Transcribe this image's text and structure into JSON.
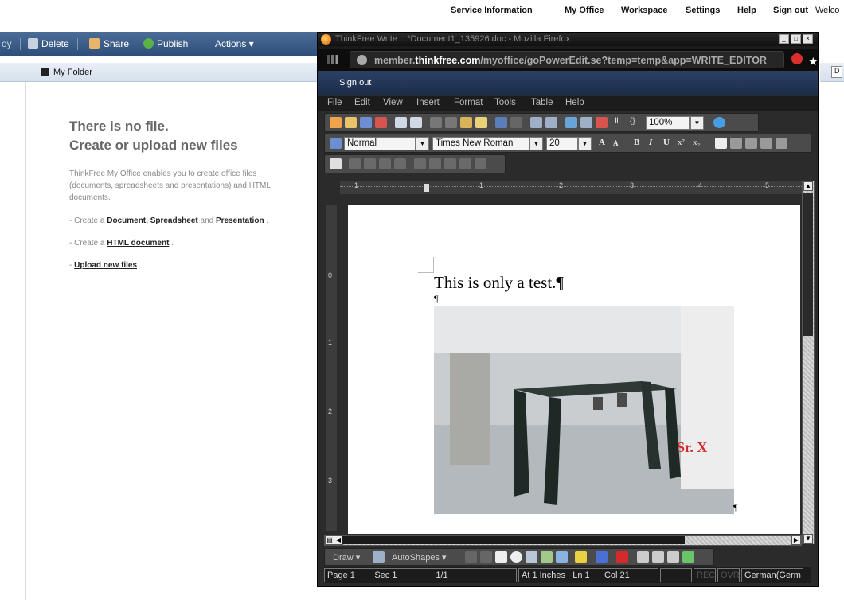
{
  "top_nav": {
    "service_information": "Service Information",
    "my_office": "My Office",
    "workspace": "Workspace",
    "settings": "Settings",
    "help": "Help",
    "sign_out": "Sign out",
    "welcome": "Welco"
  },
  "toolbar": {
    "prefix": "oy",
    "delete": "Delete",
    "share": "Share",
    "publish": "Publish",
    "actions": "Actions ▾"
  },
  "folder": {
    "label": "My Folder"
  },
  "empty_state": {
    "line1": "There is no file.",
    "line2": "Create or upload new files",
    "description": "ThinkFree My Office enables you to create office files (documents, spreadsheets and presentations) and HTML documents.",
    "create_prefix": "- Create a",
    "document": "Document,",
    "spreadsheet": "Spreadsheet",
    "and": "and",
    "presentation": "Presentation",
    "period": ".",
    "create_html_prefix": "- Create a",
    "html_document": "HTML document",
    "upload_prefix": "-",
    "upload": "Upload new files"
  },
  "firefox": {
    "title": "ThinkFree Write :: *Document1_135926.doc - Mozilla Firefox",
    "url_prefix": "member.",
    "url_domain": "thinkfree.com",
    "url_path": "/myoffice/goPowerEdit.se?temp=temp&app=WRITE_EDITOR",
    "sign_out": "Sign out"
  },
  "editor": {
    "menu": [
      "File",
      "Edit",
      "View",
      "Insert",
      "Format",
      "Tools",
      "Table",
      "Help"
    ],
    "zoom": "100%",
    "style": "Normal",
    "font": "Times New Roman",
    "size": "20",
    "ruler_numbers": [
      "1",
      "1",
      "2",
      "3",
      "4",
      "5"
    ],
    "vruler_numbers": [
      "0",
      "1",
      "2",
      "3"
    ],
    "doc_text": "This is only a test.¶",
    "pilcrow": "¶",
    "photo_text": "Sr. X",
    "draw": "Draw ▾",
    "autoshapes": "AutoShapes ▾",
    "status": {
      "page": "Page 1",
      "sec": "Sec 1",
      "pages": "1/1",
      "at": "At 1 Inches",
      "ln": "Ln 1",
      "col": "Col 21",
      "rec": "REC",
      "ovr": "OVR",
      "lang": "German(Germ"
    }
  },
  "colors": {
    "toolbar_bg": "#3b5d88",
    "signout_bar": "#243658",
    "firefox_chrome": "#1b1b1b"
  }
}
